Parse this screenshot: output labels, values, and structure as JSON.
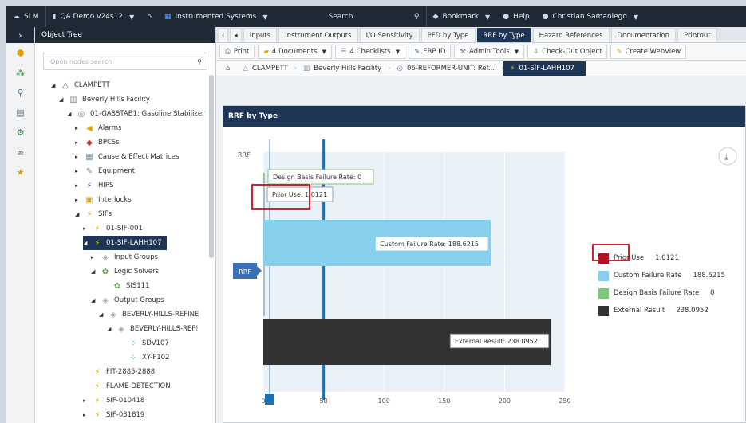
{
  "topbar": {
    "app": "SLM",
    "instance": "QA Demo v24s12",
    "module": "Instrumented Systems",
    "search": "Search",
    "bookmark": "Bookmark",
    "help": "Help",
    "user": "Christian Samaniego"
  },
  "tree": {
    "title": "Object Tree",
    "search_placeholder": "Open nodes search",
    "nodes": [
      {
        "label": "CLAMPETT",
        "icon": "site-icon"
      },
      {
        "label": "Beverly Hills Facility",
        "icon": "facility-icon"
      },
      {
        "label": "01-GASSTAB1: Gasoline Stabilizer",
        "icon": "unit-icon"
      },
      {
        "label": "Alarms",
        "icon": "alarm-icon"
      },
      {
        "label": "BPCSs",
        "icon": "bpcs-icon"
      },
      {
        "label": "Cause & Effect Matrices",
        "icon": "matrix-icon"
      },
      {
        "label": "Equipment",
        "icon": "equipment-icon"
      },
      {
        "label": "HIPS",
        "icon": "hips-icon"
      },
      {
        "label": "Interlocks",
        "icon": "interlock-icon"
      },
      {
        "label": "SIFs",
        "icon": "sif-icon"
      },
      {
        "label": "01-SIF-001",
        "icon": "sif-icon"
      },
      {
        "label": "01-SIF-LAHH107",
        "icon": "sif-icon"
      },
      {
        "label": "Input Groups",
        "icon": "group-icon"
      },
      {
        "label": "Logic Solvers",
        "icon": "solver-icon"
      },
      {
        "label": "SIS111",
        "icon": "solver-icon"
      },
      {
        "label": "Output Groups",
        "icon": "group-icon"
      },
      {
        "label": "BEVERLY-HILLS-REFINE",
        "icon": "group-icon"
      },
      {
        "label": "BEVERLY-HILLS-REF!",
        "icon": "group-icon"
      },
      {
        "label": "SDV107",
        "icon": "device-icon"
      },
      {
        "label": "XY-P102",
        "icon": "device-icon"
      },
      {
        "label": "FIT-2885-2888",
        "icon": "sif-icon"
      },
      {
        "label": "FLAME-DETECTION",
        "icon": "sif-icon"
      },
      {
        "label": "SIF-010418",
        "icon": "sif-icon"
      },
      {
        "label": "SIF-031819",
        "icon": "sif-icon"
      }
    ]
  },
  "tabs": [
    "Inputs",
    "Instrument Outputs",
    "I/O Sensitivity",
    "PFD by Type",
    "RRF by Type",
    "Hazard References",
    "Documentation",
    "Printout"
  ],
  "active_tab": "RRF by Type",
  "toolbar": {
    "print": "Print",
    "documents": "4 Documents",
    "checklists": "4 Checklists",
    "erp": "ERP ID",
    "admin": "Admin Tools",
    "checkout": "Check-Out Object",
    "webview": "Create WebView"
  },
  "breadcrumb": [
    "CLAMPETT",
    "Beverly Hills Facility",
    "06-REFORMER-UNIT: Ref...",
    "01-SIF-LAHH107"
  ],
  "panel": {
    "title": "RRF by Type"
  },
  "chart_data": {
    "type": "bar",
    "orientation": "horizontal",
    "xlim": [
      0,
      250
    ],
    "xticks": [
      "0",
      "50",
      "100",
      "150",
      "200",
      "250"
    ],
    "y_axis_label": "RRF",
    "category_label": "RRF",
    "reference_line": 50,
    "series": [
      {
        "name": "Prior Use",
        "value": 1.0121,
        "color": "#b01321",
        "label": "Prior Use: 1.0121"
      },
      {
        "name": "Design Basis Failure Rate",
        "value": 0,
        "color": "#7dc57a",
        "label": "Design Basis Failure Rate: 0"
      },
      {
        "name": "Custom Failure Rate",
        "value": 188.6215,
        "color": "#86d0ec",
        "label": "Custom Failure Rate: 188.6215"
      },
      {
        "name": "External Result",
        "value": 238.0952,
        "color": "#333333",
        "label": "External Result: 238.0952"
      }
    ],
    "legend": [
      {
        "name": "Prior Use",
        "value": "1.0121",
        "color": "#b01321"
      },
      {
        "name": "Custom Failure Rate",
        "value": "188.6215",
        "color": "#86d0ec"
      },
      {
        "name": "Design Basis Failure Rate",
        "value": "0",
        "color": "#7dc57a"
      },
      {
        "name": "External Result",
        "value": "238.0952",
        "color": "#333333"
      }
    ]
  }
}
